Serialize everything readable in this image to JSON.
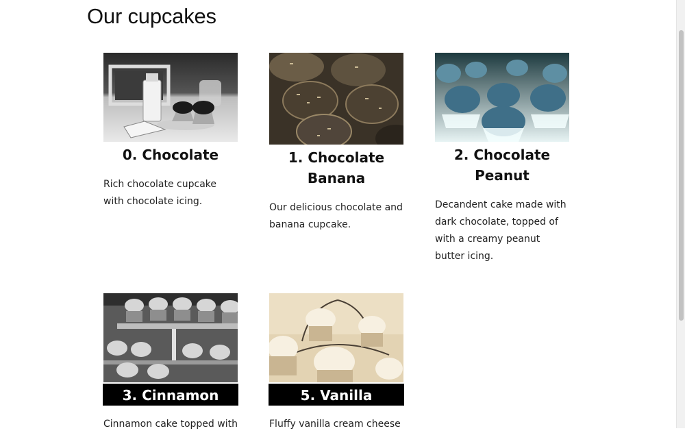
{
  "page": {
    "title": "Our cupcakes"
  },
  "cupcakes": [
    {
      "title": "0. Chocolate",
      "description": "Rich chocolate cupcake with chocolate icing.",
      "image": "grayscale-cupcake-photo"
    },
    {
      "title": "1. Chocolate Banana",
      "description": "Our delicious chocolate and banana cupcake.",
      "image": "sepia-cupcake-photo"
    },
    {
      "title": "2. Chocolate Peanut",
      "description": "Decandent cake made with dark chocolate, topped of with a creamy peanut butter icing.",
      "image": "inverted-color-cupcake-photo"
    },
    {
      "title": "3. Cinnamon",
      "description": "Cinnamon cake topped with",
      "image": "grayscale-cupcake-tray-photo"
    },
    {
      "title": "5. Vanilla",
      "description": "Fluffy vanilla cream cheese",
      "image": "sepia-cupcake-stand-photo"
    }
  ],
  "colors": {
    "background": "#ffffff",
    "text": "#222222",
    "banner": "#000000",
    "banner_text": "#ffffff"
  }
}
